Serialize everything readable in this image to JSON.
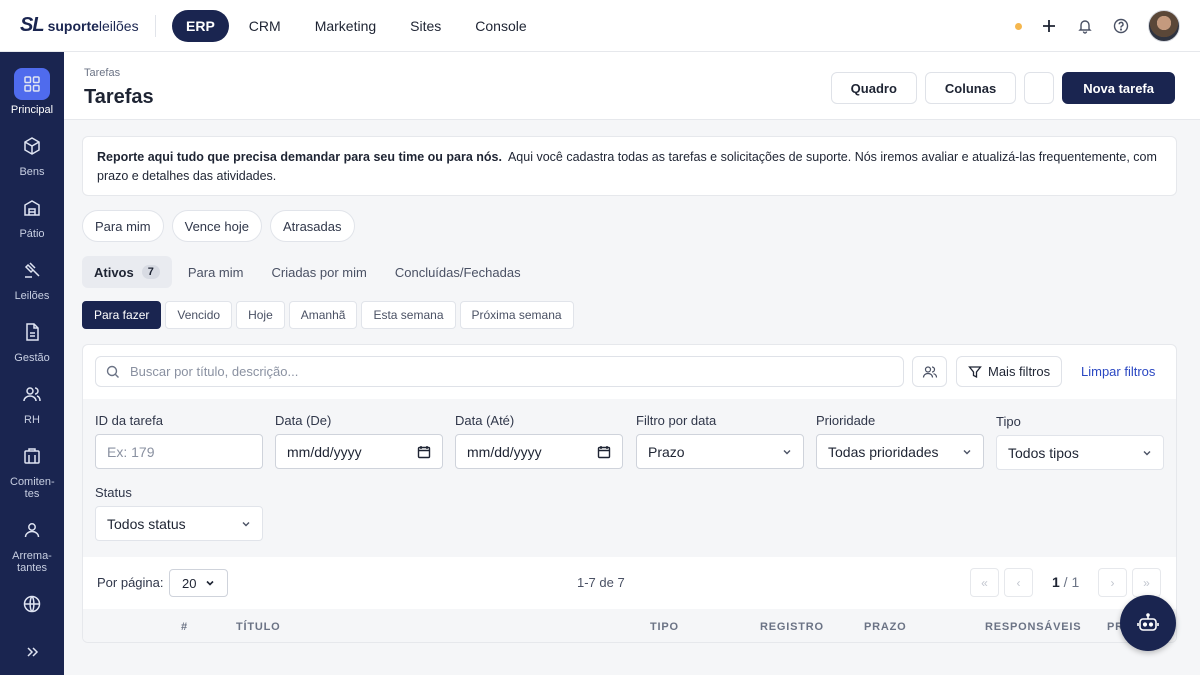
{
  "brand": {
    "mark": "SL",
    "name_bold": "suporte",
    "name_rest": "leilões"
  },
  "topnav": [
    "ERP",
    "CRM",
    "Marketing",
    "Sites",
    "Console"
  ],
  "sidebar": {
    "items": [
      "Principal",
      "Bens",
      "Pátio",
      "Leilões",
      "Gestão",
      "RH",
      "Comiten-tes",
      "Arrema-tantes"
    ]
  },
  "header": {
    "breadcrumb": "Tarefas",
    "title": "Tarefas",
    "buttons": {
      "board": "Quadro",
      "columns": "Colunas",
      "new_task": "Nova tarefa"
    }
  },
  "info": {
    "bold": "Reporte aqui tudo que precisa demandar para seu time ou para nós.",
    "text": "Aqui você cadastra todas as tarefas e solicitações de suporte. Nós iremos avaliar e atualizá-las frequentemente, com prazo e detalhes das atividades."
  },
  "quick_chips": [
    "Para mim",
    "Vence hoje",
    "Atrasadas"
  ],
  "tabs": [
    {
      "label": "Ativos",
      "count": "7"
    },
    {
      "label": "Para mim"
    },
    {
      "label": "Criadas por mim"
    },
    {
      "label": "Concluídas/Fechadas"
    }
  ],
  "subfilters": [
    "Para fazer",
    "Vencido",
    "Hoje",
    "Amanhã",
    "Esta semana",
    "Próxima semana"
  ],
  "search": {
    "placeholder": "Buscar por título, descrição...",
    "more_filters": "Mais filtros",
    "clear": "Limpar filtros"
  },
  "filters": {
    "task_id": {
      "label": "ID da tarefa",
      "placeholder": "Ex: 179"
    },
    "date_from": {
      "label": "Data (De)",
      "value": "mm/dd/yyyy"
    },
    "date_to": {
      "label": "Data (Até)",
      "value": "mm/dd/yyyy"
    },
    "date_filter": {
      "label": "Filtro por data",
      "value": "Prazo"
    },
    "priority": {
      "label": "Prioridade",
      "value": "Todas prioridades"
    },
    "type": {
      "label": "Tipo",
      "value": "Todos tipos"
    },
    "status": {
      "label": "Status",
      "value": "Todos status"
    }
  },
  "pager": {
    "per_page_label": "Por página:",
    "per_page": "20",
    "range": "1-7 de 7",
    "page": "1",
    "total": "1",
    "first": "«",
    "prev": "‹",
    "next": "›",
    "last": "»"
  },
  "table": {
    "columns": [
      "#",
      "TÍTULO",
      "TIPO",
      "REGISTRO",
      "PRAZO",
      "RESPONSÁVEIS",
      "PR"
    ]
  },
  "colors": {
    "primary": "#1a2550",
    "accent": "#4f6bed",
    "link": "#2a47c2",
    "status_dot": "#f5b74e"
  },
  "icons": [
    "plus-icon",
    "bell-icon",
    "help-icon",
    "search-icon",
    "users-icon",
    "filter-icon",
    "chevron-down-icon",
    "calendar-icon",
    "robot-icon",
    "expand-icon"
  ]
}
